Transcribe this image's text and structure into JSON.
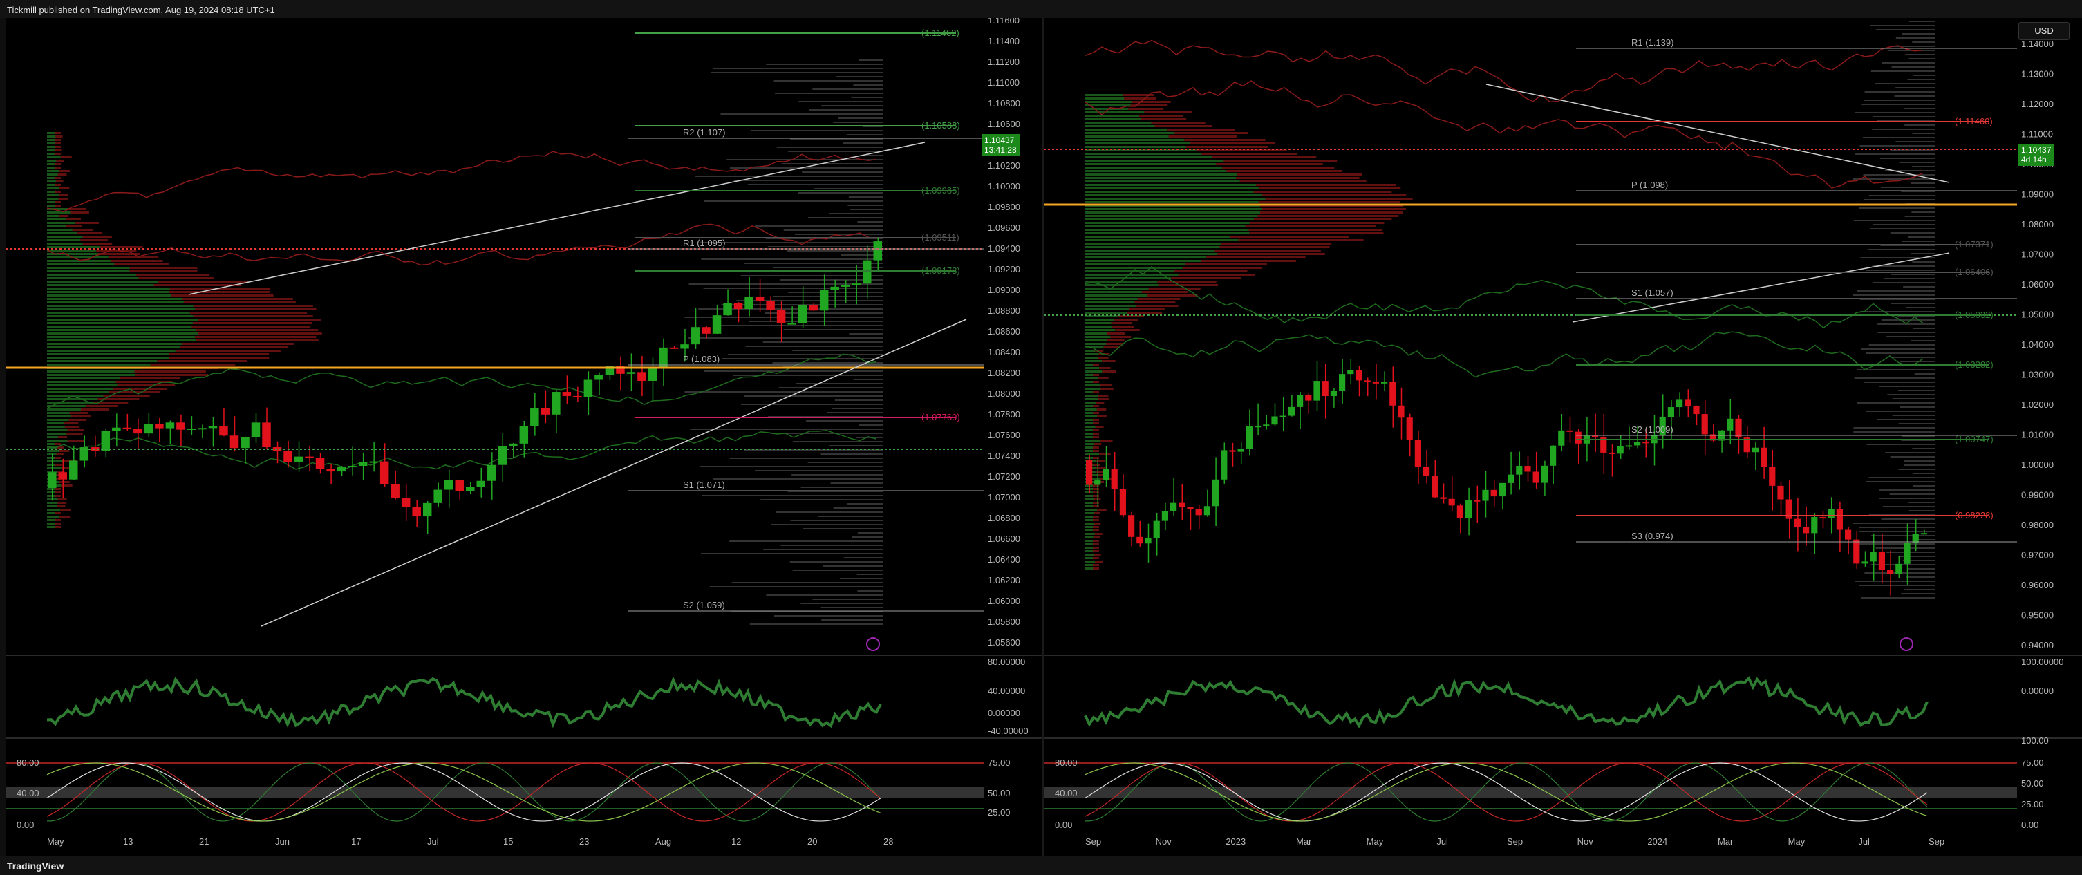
{
  "header": {
    "published": "Tickmill published on TradingView.com, Aug 19, 2024 08:18 UTC+1"
  },
  "footer": {
    "brand": "TradingView"
  },
  "colors": {
    "bull": "#21a621",
    "bear": "#e2121c",
    "pivot": "#9e9e9e",
    "poc": "#f5a623",
    "bg": "#000000"
  },
  "left_chart": {
    "price_tag": {
      "price": "1.10437",
      "countdown": "13:41:28"
    },
    "y_ticks": [
      "1.11600",
      "1.11400",
      "1.11200",
      "1.11000",
      "1.10800",
      "1.10600",
      "1.10400",
      "1.10200",
      "1.10000",
      "1.09800",
      "1.09600",
      "1.09400",
      "1.09200",
      "1.09000",
      "1.08800",
      "1.08600",
      "1.08400",
      "1.08200",
      "1.08000",
      "1.07800",
      "1.07600",
      "1.07400",
      "1.07200",
      "1.07000",
      "1.06800",
      "1.06600",
      "1.06400",
      "1.06200",
      "1.06000",
      "1.05800",
      "1.05600"
    ],
    "x_ticks": [
      "May",
      "13",
      "21",
      "Jun",
      "17",
      "Jul",
      "15",
      "23",
      "Aug",
      "12",
      "20",
      "28"
    ],
    "pivots": [
      "R2 (1.107)",
      "R1 (1.095)",
      "P (1.083)",
      "S1 (1.071)",
      "S2 (1.059)"
    ],
    "fib_labels": [
      "(1.11462)",
      "(1.10588)",
      "(1.09985)",
      "(1.09511)",
      "(1.09178)",
      "(1.07769)"
    ],
    "osc1_ticks": [
      "80.00000",
      "40.00000",
      "0.00000",
      "-40.00000"
    ],
    "osc2_left": [
      "80.00",
      "40.00",
      "0.00"
    ],
    "osc2_right": [
      "75.00",
      "50.00",
      "25.00"
    ]
  },
  "right_chart": {
    "currency": "USD",
    "price_tag": {
      "price": "1.10437",
      "countdown": "4d 14h"
    },
    "y_ticks": [
      "1.14000",
      "1.13000",
      "1.12000",
      "1.11000",
      "1.10000",
      "1.09000",
      "1.08000",
      "1.07000",
      "1.06000",
      "1.05000",
      "1.04000",
      "1.03000",
      "1.02000",
      "1.01000",
      "1.00000",
      "0.99000",
      "0.98000",
      "0.97000",
      "0.96000",
      "0.95000",
      "0.94000"
    ],
    "x_ticks": [
      "Sep",
      "Nov",
      "2023",
      "Mar",
      "May",
      "Jul",
      "Sep",
      "Nov",
      "2024",
      "Mar",
      "May",
      "Jul",
      "Sep"
    ],
    "pivots": [
      "R1 (1.139)",
      "P (1.098)",
      "S1 (1.057)",
      "S2 (1.009)",
      "S3 (0.974)"
    ],
    "fib_labels": [
      "(1.11460)",
      "(1.07371)",
      "(1.06406)",
      "(1.05032)",
      "(1.03282)",
      "(1.00747)",
      "(0.98228)"
    ],
    "osc1_ticks": [
      "100.00000",
      "0.00000"
    ],
    "osc2_left": [
      "80.00",
      "40.00",
      "0.00"
    ],
    "osc2_right": [
      "100.00",
      "75.00",
      "50.00",
      "25.00",
      "0.00"
    ]
  }
}
